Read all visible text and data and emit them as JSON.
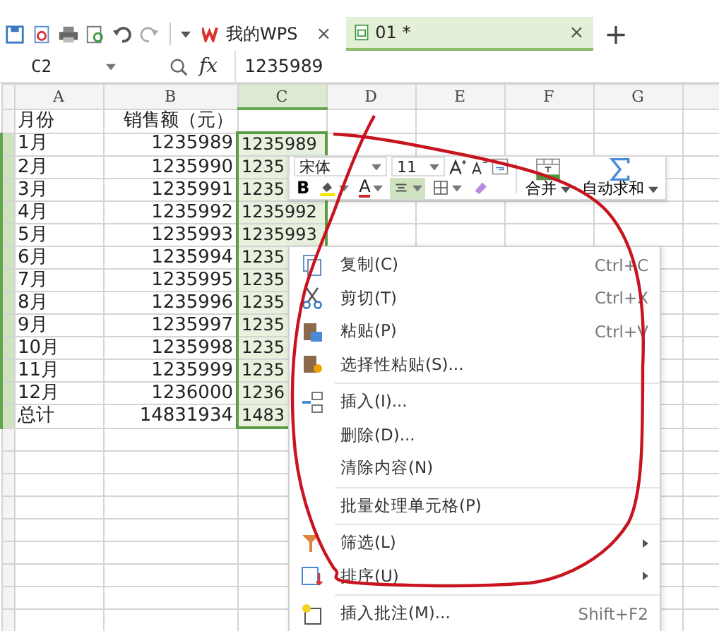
{
  "tabs": [
    {
      "label": "我的WPS",
      "selected": false,
      "close": "×"
    },
    {
      "label": "01 *",
      "selected": true,
      "close": "×"
    }
  ],
  "new_tab": "+",
  "name_box": "C2",
  "formula_label": "fx",
  "formula": "1235989",
  "columns": [
    {
      "label": "A",
      "selected": false
    },
    {
      "label": "B",
      "selected": false
    },
    {
      "label": "C",
      "selected": true
    },
    {
      "label": "D",
      "selected": false
    },
    {
      "label": "E",
      "selected": false
    },
    {
      "label": "F",
      "selected": false
    },
    {
      "label": "G",
      "selected": false
    }
  ],
  "rows": [
    {
      "selected": false,
      "cells": [
        "月份",
        "销售额（元）",
        ""
      ]
    },
    {
      "selected": true,
      "cells": [
        "1月",
        "1235989",
        "1235989"
      ]
    },
    {
      "selected": true,
      "cells": [
        "2月",
        "1235990",
        "1235"
      ]
    },
    {
      "selected": true,
      "cells": [
        "3月",
        "1235991",
        "1235"
      ]
    },
    {
      "selected": true,
      "cells": [
        "4月",
        "1235992",
        "1235992"
      ]
    },
    {
      "selected": true,
      "cells": [
        "5月",
        "1235993",
        "1235993"
      ]
    },
    {
      "selected": true,
      "cells": [
        "6月",
        "1235994",
        "1235"
      ]
    },
    {
      "selected": true,
      "cells": [
        "7月",
        "1235995",
        "1235"
      ]
    },
    {
      "selected": true,
      "cells": [
        "8月",
        "1235996",
        "1235"
      ]
    },
    {
      "selected": true,
      "cells": [
        "9月",
        "1235997",
        "1235"
      ]
    },
    {
      "selected": true,
      "cells": [
        "10月",
        "1235998",
        "1235"
      ]
    },
    {
      "selected": true,
      "cells": [
        "11月",
        "1235999",
        "1235"
      ]
    },
    {
      "selected": true,
      "cells": [
        "12月",
        "1236000",
        "1236"
      ]
    },
    {
      "selected": true,
      "cells": [
        "总计",
        "14831934",
        "1483"
      ]
    }
  ],
  "mini_toolbar": {
    "font": "宋体",
    "size": "11",
    "merge": "合并",
    "autosum": "自动求和",
    "format_buttons": [
      {
        "kind": "bold",
        "label": "B",
        "selected": false
      },
      {
        "kind": "fill",
        "selected": false
      },
      {
        "kind": "font-color",
        "label": "A",
        "selected": false
      },
      {
        "kind": "align",
        "selected": true
      },
      {
        "kind": "borders",
        "selected": false
      },
      {
        "kind": "eraser",
        "selected": false
      }
    ]
  },
  "context_menu": [
    {
      "kind": "item",
      "label": "复制(C)",
      "shortcut": "Ctrl+C",
      "submenu": false
    },
    {
      "kind": "item",
      "label": "剪切(T)",
      "shortcut": "Ctrl+X",
      "submenu": false
    },
    {
      "kind": "item",
      "label": "粘贴(P)",
      "shortcut": "Ctrl+V",
      "submenu": false
    },
    {
      "kind": "item",
      "label": "选择性粘贴(S)...",
      "submenu": false
    },
    {
      "kind": "separator"
    },
    {
      "kind": "item",
      "label": "插入(I)...",
      "submenu": false
    },
    {
      "kind": "item",
      "label": "删除(D)...",
      "submenu": false
    },
    {
      "kind": "item",
      "label": "清除内容(N)",
      "submenu": false
    },
    {
      "kind": "separator"
    },
    {
      "kind": "item",
      "label": "批量处理单元格(P)",
      "submenu": false
    },
    {
      "kind": "separator"
    },
    {
      "kind": "item",
      "label": "筛选(L)",
      "submenu": true
    },
    {
      "kind": "item",
      "label": "排序(U)",
      "submenu": true
    },
    {
      "kind": "separator"
    },
    {
      "kind": "item",
      "label": "插入批注(M)...",
      "shortcut": "Shift+F2",
      "submenu": false
    }
  ]
}
